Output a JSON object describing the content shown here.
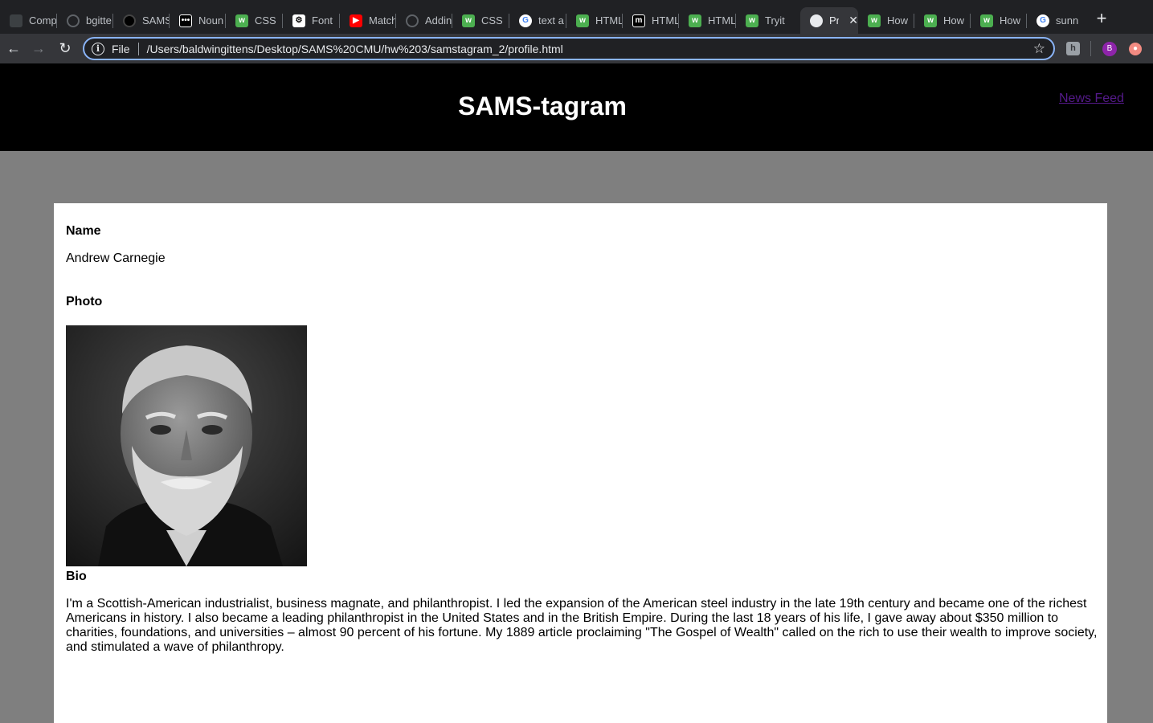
{
  "browser": {
    "tabs": [
      {
        "title": "Comp",
        "icon": "bag-icon"
      },
      {
        "title": "bgitte",
        "icon": "github-icon"
      },
      {
        "title": "SAMS",
        "icon": "sams-icon"
      },
      {
        "title": "Noun",
        "icon": "noun-project-icon"
      },
      {
        "title": "CSS",
        "icon": "w3schools-icon"
      },
      {
        "title": "Font",
        "icon": "cog-icon"
      },
      {
        "title": "Match",
        "icon": "youtube-icon"
      },
      {
        "title": "Addin",
        "icon": "github-icon"
      },
      {
        "title": "CSS",
        "icon": "w3schools-icon"
      },
      {
        "title": "text a",
        "icon": "google-icon"
      },
      {
        "title": "HTML",
        "icon": "w3schools-icon"
      },
      {
        "title": "HTML",
        "icon": "mdn-icon"
      },
      {
        "title": "HTML",
        "icon": "w3schools-icon"
      },
      {
        "title": "Tryit",
        "icon": "w3schools-icon"
      },
      {
        "title": "Pr",
        "icon": "globe-icon",
        "active": true
      },
      {
        "title": "How",
        "icon": "w3schools-icon"
      },
      {
        "title": "How",
        "icon": "w3schools-icon"
      },
      {
        "title": "How",
        "icon": "w3schools-icon"
      },
      {
        "title": "sunn",
        "icon": "google-icon"
      }
    ],
    "address": {
      "scheme": "File",
      "url": "/Users/baldwingittens/Desktop/SAMS%20CMU/hw%203/samstagram_2/profile.html"
    },
    "profile_initial": "B"
  },
  "site": {
    "title": "SAMS-tagram",
    "nav_link": "News Feed"
  },
  "profile": {
    "name_label": "Name",
    "name": "Andrew Carnegie",
    "photo_label": "Photo",
    "bio_label": "Bio",
    "bio": "I'm a Scottish-American industrialist, business magnate, and philanthropist. I led the expansion of the American steel industry in the late 19th century and became one of the richest Americans in history. I also became a leading philanthropist in the United States and in the British Empire. During the last 18 years of his life, I gave away about $350 million to charities, foundations, and universities – almost 90 percent of his fortune. My 1889 article proclaiming \"The Gospel of Wealth\" called on the rich to use their wealth to improve society, and stimulated a wave of philanthropy."
  }
}
